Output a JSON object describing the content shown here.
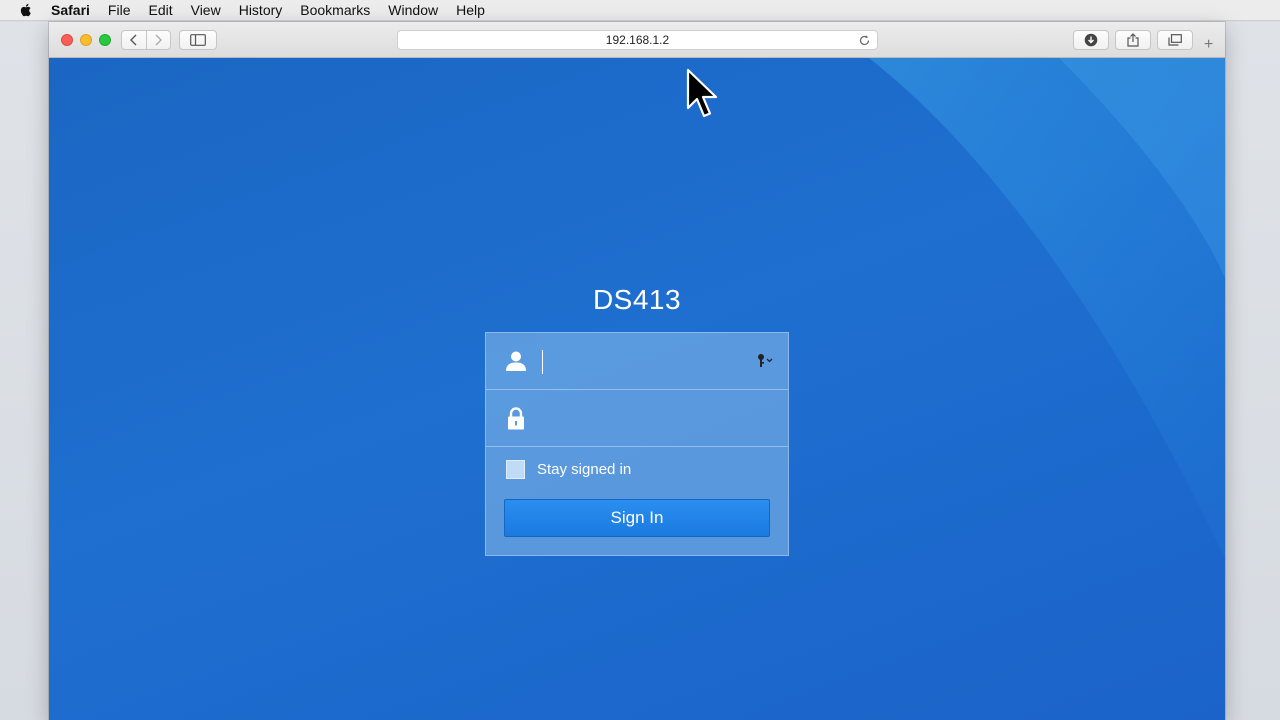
{
  "menubar": {
    "app_name": "Safari",
    "items": [
      "File",
      "Edit",
      "View",
      "History",
      "Bookmarks",
      "Window",
      "Help"
    ]
  },
  "browser": {
    "url": "192.168.1.2",
    "new_tab_label": "+"
  },
  "login": {
    "device_name": "DS413",
    "username_value": "",
    "password_value": "",
    "stay_signed_in_label": "Stay signed in",
    "stay_signed_in_checked": false,
    "sign_in_label": "Sign In"
  },
  "colors": {
    "page_background": "#1e6fd0",
    "sign_in_button": "#2185e8",
    "close": "#fc5f57",
    "minimize": "#fdbc2e",
    "maximize": "#28c840"
  },
  "icons": [
    "apple-icon",
    "back-icon",
    "forward-icon",
    "sidebar-icon",
    "reload-icon",
    "download-icon",
    "share-icon",
    "tabs-icon",
    "user-icon",
    "lock-icon",
    "key-icon",
    "cursor-icon"
  ]
}
